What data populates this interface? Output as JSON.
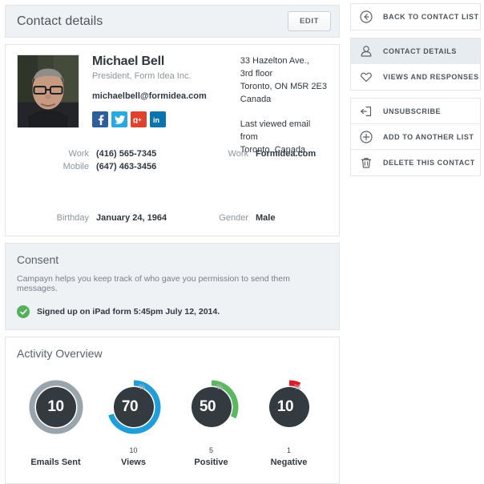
{
  "header": {
    "title": "Contact details",
    "edit_label": "EDIT"
  },
  "contact": {
    "name": "Michael Bell",
    "job_title": "President, Form Idea Inc.",
    "email": "michaelbell@formidea.com",
    "socials": [
      {
        "name": "facebook",
        "glyph": "f"
      },
      {
        "name": "twitter",
        "glyph": "t"
      },
      {
        "name": "google-plus",
        "glyph": "g+"
      },
      {
        "name": "linkedin",
        "glyph": "in"
      }
    ],
    "address": {
      "line1": "33 Hazelton Ave.,",
      "line2": "3rd floor",
      "line3": "Toronto, ON M5R 2E3",
      "line4": "Canada"
    },
    "last_viewed": {
      "line1": "Last viewed email from",
      "line2": "Toronto, Canada"
    },
    "fields": {
      "phone_work_label": "Work",
      "phone_work_value": "(416) 565-7345",
      "phone_mobile_label": "Mobile",
      "phone_mobile_value": "(647) 463-3456",
      "web_work_label": "Work",
      "web_work_value": "Formidea.com",
      "birthday_label": "Birthday",
      "birthday_value": "January 24, 1964",
      "gender_label": "Gender",
      "gender_value": "Male"
    }
  },
  "consent": {
    "title": "Consent",
    "description": "Campayn helps you keep track of who gave you permission to send them messages.",
    "status": "Signed up on iPad form 5:45pm July 12, 2014."
  },
  "activity": {
    "title": "Activity Overview"
  },
  "chart_data": {
    "type": "pie",
    "title": "Activity Overview",
    "legend_position": "below",
    "items": [
      {
        "label": "Emails Sent",
        "count": "",
        "display": "10",
        "percent": 100,
        "show_percent_sign": false,
        "color": "#9aa4ac",
        "track": "#9aa4ac"
      },
      {
        "label": "Views",
        "count": "10",
        "display": "70",
        "percent": 70,
        "show_percent_sign": true,
        "color": "#1f9ed9",
        "track": "#ffffff"
      },
      {
        "label": "Positive",
        "count": "5",
        "display": "50",
        "percent": 32,
        "show_percent_sign": true,
        "color": "#5cb860",
        "track": "#ffffff"
      },
      {
        "label": "Negative",
        "count": "1",
        "display": "10",
        "percent": 7,
        "show_percent_sign": true,
        "color": "#e01b24",
        "track": "#ffffff"
      }
    ]
  },
  "sidebar": {
    "groups": [
      {
        "items": [
          {
            "label": "BACK TO CONTACT LIST",
            "icon": "arrow-left-circle-icon",
            "active": false
          }
        ]
      },
      {
        "items": [
          {
            "label": "CONTACT DETAILS",
            "icon": "person-icon",
            "active": true
          },
          {
            "label": "VIEWS AND RESPONSES",
            "icon": "heart-icon",
            "active": false
          }
        ]
      },
      {
        "items": [
          {
            "label": "UNSUBSCRIBE",
            "icon": "logout-icon",
            "active": false
          },
          {
            "label": "ADD TO ANOTHER LIST",
            "icon": "plus-circle-icon",
            "active": false
          },
          {
            "label": "DELETE THIS CONTACT",
            "icon": "trash-icon",
            "active": false
          }
        ]
      }
    ]
  }
}
